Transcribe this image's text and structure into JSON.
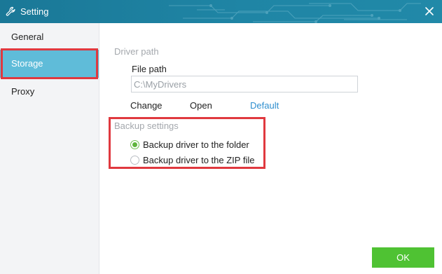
{
  "window": {
    "title": "Setting",
    "icon": "wrench-icon",
    "close_icon": "close-icon"
  },
  "sidebar": {
    "items": [
      {
        "label": "General",
        "selected": false
      },
      {
        "label": "Storage",
        "selected": true
      },
      {
        "label": "Proxy",
        "selected": false
      }
    ]
  },
  "storage": {
    "driver_path_section": "Driver path",
    "file_path_label": "File path",
    "file_path_value": "C:\\MyDrivers",
    "change_label": "Change",
    "open_label": "Open",
    "default_label": "Default",
    "backup_section": "Backup settings",
    "backup_options": [
      {
        "label": "Backup driver to the folder",
        "checked": true
      },
      {
        "label": "Backup driver to the ZIP file",
        "checked": false
      }
    ]
  },
  "footer": {
    "ok_label": "OK"
  },
  "colors": {
    "titlebar": "#1f7f9e",
    "selected_nav": "#5fbcd9",
    "ok_button": "#4fc233",
    "link": "#2f8fcf",
    "highlight": "#e0393f",
    "radio_checked": "#5fb53d"
  }
}
